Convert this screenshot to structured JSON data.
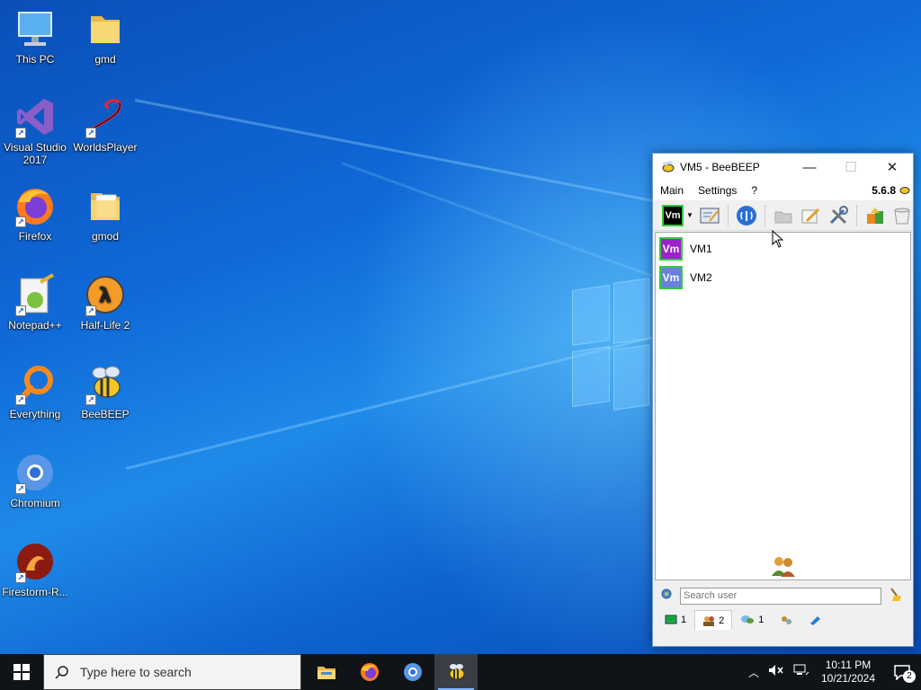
{
  "desktop": {
    "icons": [
      {
        "label": "This PC",
        "icon": "monitor-icon"
      },
      {
        "label": "gmd",
        "icon": "folder-icon"
      },
      {
        "label": "Visual Studio 2017",
        "icon": "visual-studio-icon"
      },
      {
        "label": "WorldsPlayer",
        "icon": "worldsplayer-icon"
      },
      {
        "label": "Firefox",
        "icon": "firefox-icon"
      },
      {
        "label": "gmod",
        "icon": "folder-icon"
      },
      {
        "label": "Notepad++",
        "icon": "notepadpp-icon"
      },
      {
        "label": "Half-Life 2",
        "icon": "half-life-icon"
      },
      {
        "label": "Everything",
        "icon": "everything-search-icon"
      },
      {
        "label": "BeeBEEP",
        "icon": "bee-icon"
      },
      {
        "label": "Chromium",
        "icon": "chromium-icon"
      },
      {
        "label": "Firestorm-R...",
        "icon": "firestorm-icon"
      }
    ]
  },
  "window": {
    "title": "VM5 - BeeBEEP",
    "version": "5.6.8",
    "menu": [
      "Main",
      "Settings",
      "?"
    ],
    "controls": {
      "minimize": "—",
      "maximize": "☐",
      "close": "✕"
    },
    "users": [
      {
        "badge": "Vm",
        "name": "VM1",
        "color": "#a020d0"
      },
      {
        "badge": "Vm",
        "name": "VM2",
        "color": "#6b7fe0"
      }
    ],
    "search": {
      "placeholder": "Search user",
      "value": ""
    },
    "tabs": [
      {
        "icon": "chat-icon",
        "count": "1"
      },
      {
        "icon": "users-icon",
        "count": "2"
      },
      {
        "icon": "groups-icon",
        "count": "1"
      },
      {
        "icon": "network-icon",
        "count": ""
      },
      {
        "icon": "plugin-icon",
        "count": ""
      }
    ],
    "status_badge": "Vm"
  },
  "taskbar": {
    "search_placeholder": "Type here to search",
    "time": "10:11 PM",
    "date": "10/21/2024",
    "notification_count": "2"
  }
}
